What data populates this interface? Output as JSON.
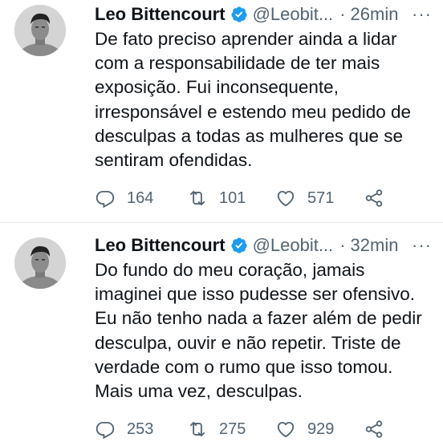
{
  "tweets": [
    {
      "name": "Leo Bittencourt",
      "handle": "@Leobit...",
      "time": "26min",
      "text": "De fato preciso aprender ainda a lidar com a responsabilidade de ter mais exposição. Fui inconsequente, irresponsável e estendo meu pedido de desculpas a todas as mulheres que se sentiram ofendidas.",
      "replies": "164",
      "retweets": "101",
      "likes": "571"
    },
    {
      "name": "Leo Bittencourt",
      "handle": "@Leobit...",
      "time": "32min",
      "text": "Do fundo do meu coração, jamais imaginei que isso pudesse ser ofensivo. Eu não tenho nada a fazer além de pedir desculpa, ouvir e não repetir. Triste de verdade com o rumo que isso tomou. Mais uma vez, desculpas.",
      "replies": "253",
      "retweets": "275",
      "likes": "929"
    }
  ],
  "separator": "·",
  "more_label": "···",
  "colors": {
    "text": "#0f1419",
    "secondary": "#536471",
    "verified": "#1d9bf0"
  },
  "icons": [
    "avatar",
    "verified-badge-icon",
    "more-icon",
    "reply-icon",
    "retweet-icon",
    "like-icon",
    "share-icon"
  ]
}
